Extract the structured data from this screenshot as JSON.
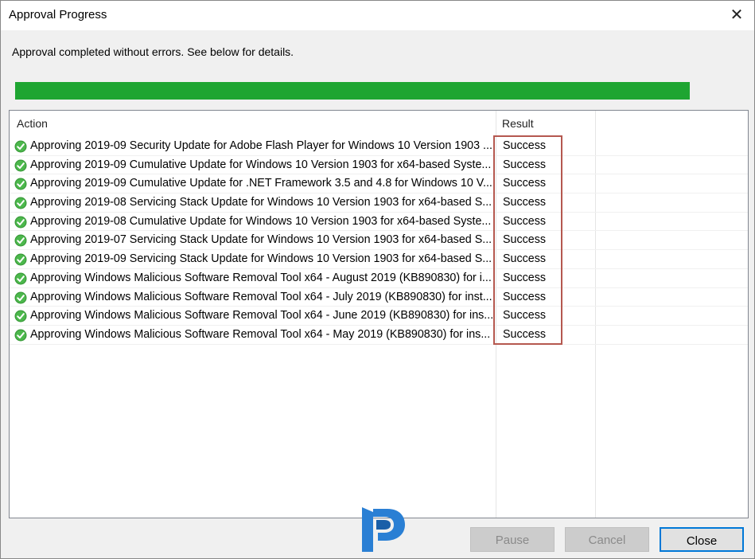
{
  "window": {
    "title": "Approval Progress",
    "close_glyph": "✕",
    "close_icon": "close-icon"
  },
  "message": "Approval completed without errors. See below for details.",
  "progress": {
    "percent": 100,
    "color": "#1ea531"
  },
  "table": {
    "headers": {
      "action": "Action",
      "result": "Result"
    },
    "rows": [
      {
        "action": "Approving 2019-09 Security Update for Adobe Flash Player for Windows 10 Version 1903 ...",
        "result": "Success",
        "icon": "success-check-icon"
      },
      {
        "action": "Approving 2019-09 Cumulative Update for Windows 10 Version 1903 for x64-based Syste...",
        "result": "Success",
        "icon": "success-check-icon"
      },
      {
        "action": "Approving 2019-09 Cumulative Update for .NET Framework 3.5 and 4.8 for Windows 10 V...",
        "result": "Success",
        "icon": "success-check-icon"
      },
      {
        "action": "Approving 2019-08 Servicing Stack Update for Windows 10 Version 1903 for x64-based S...",
        "result": "Success",
        "icon": "success-check-icon"
      },
      {
        "action": "Approving 2019-08 Cumulative Update for Windows 10 Version 1903 for x64-based Syste...",
        "result": "Success",
        "icon": "success-check-icon"
      },
      {
        "action": "Approving 2019-07 Servicing Stack Update for Windows 10 Version 1903 for x64-based S...",
        "result": "Success",
        "icon": "success-check-icon"
      },
      {
        "action": "Approving 2019-09 Servicing Stack Update for Windows 10 Version 1903 for x64-based S...",
        "result": "Success",
        "icon": "success-check-icon"
      },
      {
        "action": "Approving Windows Malicious Software Removal Tool x64 - August 2019 (KB890830) for i...",
        "result": "Success",
        "icon": "success-check-icon"
      },
      {
        "action": "Approving Windows Malicious Software Removal Tool x64 - July 2019 (KB890830) for inst...",
        "result": "Success",
        "icon": "success-check-icon"
      },
      {
        "action": "Approving Windows Malicious Software Removal Tool x64 - June 2019 (KB890830) for ins...",
        "result": "Success",
        "icon": "success-check-icon"
      },
      {
        "action": "Approving Windows Malicious Software Removal Tool x64 - May 2019 (KB890830) for ins...",
        "result": "Success",
        "icon": "success-check-icon"
      }
    ]
  },
  "buttons": {
    "pause": "Pause",
    "cancel": "Cancel",
    "close": "Close"
  },
  "colors": {
    "highlight_border": "#b5584f",
    "close_button_border": "#0078d7",
    "logo_blue": "#2a7fd4"
  },
  "logo_icon": "p-logo-icon"
}
